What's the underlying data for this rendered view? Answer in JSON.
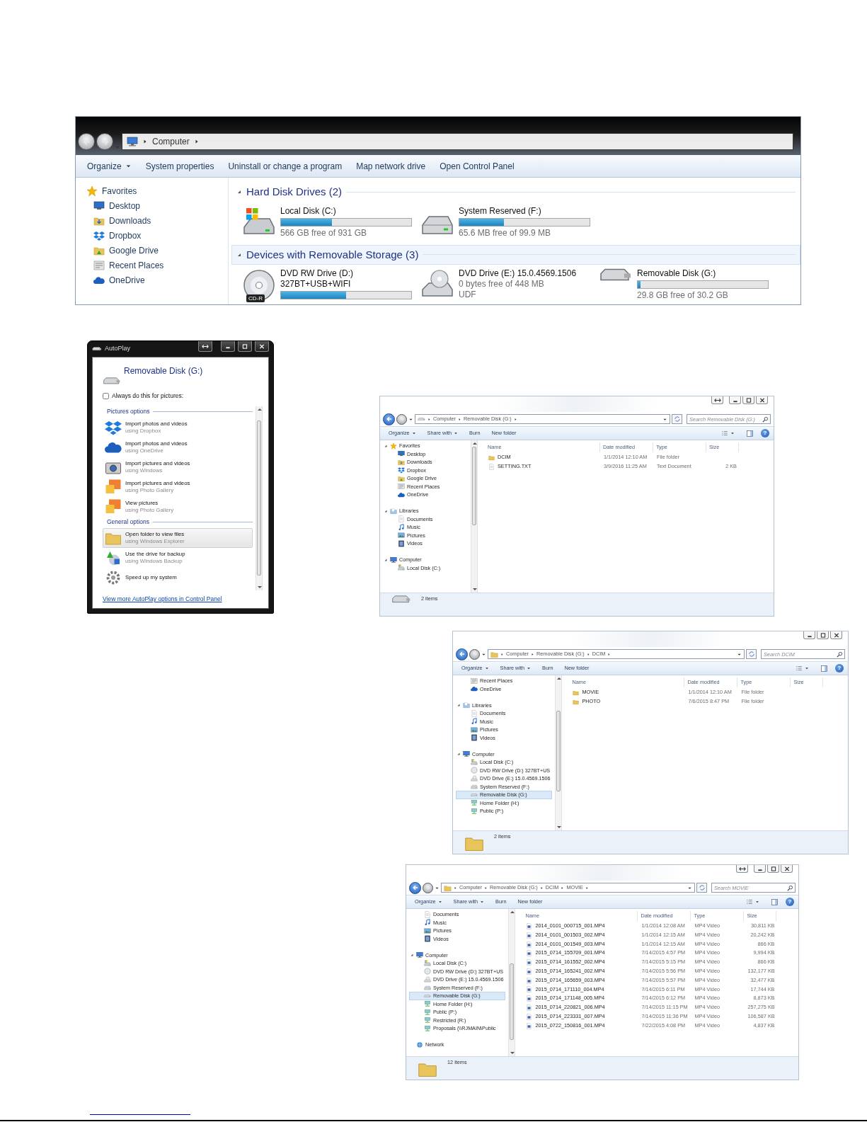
{
  "computer_window": {
    "breadcrumb": [
      "Computer"
    ],
    "toolbar": [
      {
        "label": "Organize",
        "dropdown": true
      },
      {
        "label": "System properties",
        "dropdown": false
      },
      {
        "label": "Uninstall or change a program",
        "dropdown": false
      },
      {
        "label": "Map network drive",
        "dropdown": false
      },
      {
        "label": "Open Control Panel",
        "dropdown": false
      }
    ],
    "sidebar": [
      {
        "label": "Favorites",
        "kind": "star",
        "selected": false,
        "children": [
          {
            "label": "Desktop",
            "kind": "desktop",
            "selected": false
          },
          {
            "label": "Downloads",
            "kind": "downloads",
            "selected": false
          },
          {
            "label": "Dropbox",
            "kind": "dropbox",
            "selected": false
          },
          {
            "label": "Google Drive",
            "kind": "gdrive",
            "selected": false
          },
          {
            "label": "Recent Places",
            "kind": "recent",
            "selected": false
          },
          {
            "label": "OneDrive",
            "kind": "onedrive",
            "selected": false
          }
        ]
      }
    ],
    "groups": [
      {
        "title": "Hard Disk Drives (2)",
        "selected": false,
        "drives": [
          {
            "name": "Local Disk (C:)",
            "kind": "windisk",
            "level": 0.39,
            "lines": [
              "566 GB free of 931 GB"
            ],
            "selected": false
          },
          {
            "name": "System Reserved (F:)",
            "kind": "hdd",
            "level": 0.34,
            "lines": [
              "65.6 MB free of 99.9 MB"
            ],
            "selected": false
          }
        ]
      },
      {
        "title": "Devices with Removable Storage (3)",
        "selected": true,
        "drives": [
          {
            "name": "DVD RW Drive (D:)",
            "kind": "cd",
            "badge": "CD-R",
            "label": "327BT+USB+WIFI",
            "level": 0.5,
            "selected": false
          },
          {
            "name": "DVD Drive (E:) 15.0.4569.1506",
            "kind": "dvd",
            "lines": [
              "0 bytes free of 448 MB",
              "UDF"
            ],
            "selected": false
          },
          {
            "name": "Removable Disk (G:)",
            "kind": "usb",
            "level": 0.02,
            "lines": [
              "29.8 GB free of 30.2 GB"
            ],
            "selected": false
          }
        ]
      }
    ]
  },
  "autoplay": {
    "title": "AutoPlay",
    "device": "Removable Disk (G:)",
    "always": {
      "label": "Always do this for pictures:",
      "checked": false
    },
    "sections": [
      {
        "title": "Pictures options",
        "options": [
          {
            "kind": "dropbox",
            "title": "Import photos and videos",
            "subtitle": "using Dropbox",
            "selected": false
          },
          {
            "kind": "onedrive",
            "title": "Import photos and videos",
            "subtitle": "using OneDrive",
            "selected": false
          },
          {
            "kind": "camera",
            "title": "Import pictures and videos",
            "subtitle": "using Windows",
            "selected": false
          },
          {
            "kind": "gallery",
            "title": "Import pictures and videos",
            "subtitle": "using Photo Gallery",
            "selected": false
          },
          {
            "kind": "gallery",
            "title": "View pictures",
            "subtitle": "using Photo Gallery",
            "selected": false
          }
        ]
      },
      {
        "title": "General options",
        "options": [
          {
            "kind": "folder",
            "title": "Open folder to view files",
            "subtitle": "using Windows Explorer",
            "selected": true
          },
          {
            "kind": "backup",
            "title": "Use the drive for backup",
            "subtitle": "using Windows Backup",
            "selected": false
          },
          {
            "kind": "gear",
            "title": "Speed up my system",
            "selected": false
          }
        ]
      }
    ],
    "link": "View more AutoPlay options in Control Panel"
  },
  "explorers": [
    {
      "breadcrumb": [
        "Computer",
        "Removable Disk (G:)"
      ],
      "search_placeholder": "Search Removable Disk (G:)",
      "toolbar": [
        {
          "label": "Organize",
          "dropdown": true
        },
        {
          "label": "Share with",
          "dropdown": true
        },
        {
          "label": "Burn",
          "dropdown": false
        },
        {
          "label": "New folder",
          "dropdown": false
        }
      ],
      "help": "?",
      "nav": [
        {
          "label": "Favorites",
          "kind": "star",
          "selected": false,
          "children": [
            {
              "label": "Desktop",
              "kind": "desktop",
              "selected": false
            },
            {
              "label": "Downloads",
              "kind": "downloads",
              "selected": false
            },
            {
              "label": "Dropbox",
              "kind": "dropbox",
              "selected": false
            },
            {
              "label": "Google Drive",
              "kind": "gdrive",
              "selected": false
            },
            {
              "label": "Recent Places",
              "kind": "recent",
              "selected": false
            },
            {
              "label": "OneDrive",
              "kind": "onedrive",
              "selected": false
            }
          ]
        },
        {
          "label": "Libraries",
          "kind": "libraries",
          "selected": false,
          "children": [
            {
              "label": "Documents",
              "kind": "documents",
              "selected": false
            },
            {
              "label": "Music",
              "kind": "music",
              "selected": false
            },
            {
              "label": "Pictures",
              "kind": "pictures",
              "selected": false
            },
            {
              "label": "Videos",
              "kind": "videos",
              "selected": false
            }
          ]
        },
        {
          "label": "Computer",
          "kind": "computer",
          "selected": false,
          "children": [
            {
              "label": "Local Disk (C:)",
              "kind": "windisk",
              "selected": false
            }
          ]
        }
      ],
      "columns": [
        "Name",
        "Date modified",
        "Type",
        "Size"
      ],
      "rows": [
        {
          "kind": "folder",
          "name": "DCIM",
          "date": "1/1/2014 12:10 AM",
          "type": "File folder",
          "selected": false
        },
        {
          "kind": "text",
          "name": "SETTING.TXT",
          "date": "3/9/2016 11:25 AM",
          "type": "Text Document",
          "size": "2 KB",
          "selected": false
        }
      ],
      "status": "2 items"
    },
    {
      "breadcrumb": [
        "Computer",
        "Removable Disk (G:)",
        "DCIM"
      ],
      "search_placeholder": "Search DCIM",
      "toolbar": [
        {
          "label": "Organize",
          "dropdown": true
        },
        {
          "label": "Share with",
          "dropdown": true
        },
        {
          "label": "Burn",
          "dropdown": false
        },
        {
          "label": "New folder",
          "dropdown": false
        }
      ],
      "help": "?",
      "nav": [
        {
          "children": [
            {
              "label": "Recent Places",
              "kind": "recent",
              "selected": false
            },
            {
              "label": "OneDrive",
              "kind": "onedrive",
              "selected": false
            }
          ]
        },
        {
          "label": "Libraries",
          "kind": "libraries",
          "selected": false,
          "children": [
            {
              "label": "Documents",
              "kind": "documents",
              "selected": false
            },
            {
              "label": "Music",
              "kind": "music",
              "selected": false
            },
            {
              "label": "Pictures",
              "kind": "pictures",
              "selected": false
            },
            {
              "label": "Videos",
              "kind": "videos",
              "selected": false
            }
          ]
        },
        {
          "label": "Computer",
          "kind": "computer",
          "selected": false,
          "children": [
            {
              "label": "Local Disk (C:)",
              "kind": "windisk",
              "selected": false
            },
            {
              "label": "DVD RW Drive (D:) 327BT+US",
              "kind": "cd",
              "selected": false
            },
            {
              "label": "DVD Drive (E:) 15.0.4569.1506",
              "kind": "dvd",
              "selected": false
            },
            {
              "label": "System Reserved (F:)",
              "kind": "hdd",
              "selected": false
            },
            {
              "label": "Removable Disk (G:)",
              "kind": "usb",
              "selected": true
            },
            {
              "label": "Home Folder (H:)",
              "kind": "netdrive",
              "selected": false
            },
            {
              "label": "Public (P:)",
              "kind": "netdrive",
              "selected": false
            }
          ]
        }
      ],
      "columns": [
        "Name",
        "Date modified",
        "Type",
        "Size"
      ],
      "rows": [
        {
          "kind": "folder",
          "name": "MOVIE",
          "date": "1/1/2014 12:10 AM",
          "type": "File folder",
          "selected": false
        },
        {
          "kind": "folder",
          "name": "PHOTO",
          "date": "7/6/2015 8:47 PM",
          "type": "File folder",
          "selected": false
        }
      ],
      "status": "2 items"
    },
    {
      "breadcrumb": [
        "Computer",
        "Removable Disk (G:)",
        "DCIM",
        "MOVIE"
      ],
      "search_placeholder": "Search MOVIE",
      "toolbar": [
        {
          "label": "Organize",
          "dropdown": true
        },
        {
          "label": "Share with",
          "dropdown": true
        },
        {
          "label": "Burn",
          "dropdown": false
        },
        {
          "label": "New folder",
          "dropdown": false
        }
      ],
      "help": "?",
      "nav": [
        {
          "children": [
            {
              "label": "Documents",
              "kind": "documents",
              "selected": false
            },
            {
              "label": "Music",
              "kind": "music",
              "selected": false
            },
            {
              "label": "Pictures",
              "kind": "pictures",
              "selected": false
            },
            {
              "label": "Videos",
              "kind": "videos",
              "selected": false
            }
          ]
        },
        {
          "label": "Computer",
          "kind": "computer",
          "selected": false,
          "children": [
            {
              "label": "Local Disk (C:)",
              "kind": "windisk",
              "selected": false
            },
            {
              "label": "DVD RW Drive (D:) 327BT+US",
              "kind": "cd",
              "selected": false
            },
            {
              "label": "DVD Drive (E:) 15.0.4569.1506",
              "kind": "dvd",
              "selected": false
            },
            {
              "label": "System Reserved (F:)",
              "kind": "hdd",
              "selected": false
            },
            {
              "label": "Removable Disk (G:)",
              "kind": "usb",
              "selected": true
            },
            {
              "label": "Home Folder (H:)",
              "kind": "netdrive",
              "selected": false
            },
            {
              "label": "Public (P:)",
              "kind": "netdrive",
              "selected": false
            },
            {
              "label": "Restricted (R:)",
              "kind": "netdrive",
              "selected": false
            },
            {
              "label": "Proposals (\\\\RJMAIN\\Public",
              "kind": "netdrive",
              "selected": false
            }
          ]
        },
        {
          "label": "Network",
          "kind": "network",
          "selected": false
        }
      ],
      "columns": [
        "Name",
        "Date modified",
        "Type",
        "Size"
      ],
      "rows": [
        {
          "kind": "video",
          "name": "2014_0101_000715_001.MP4",
          "date": "1/1/2014 12:08 AM",
          "type": "MP4 Video",
          "size": "30,811 KB",
          "selected": false
        },
        {
          "kind": "video",
          "name": "2014_0101_001503_002.MP4",
          "date": "1/1/2014 12:15 AM",
          "type": "MP4 Video",
          "size": "20,242 KB",
          "selected": false
        },
        {
          "kind": "video",
          "name": "2014_0101_001549_003.MP4",
          "date": "1/1/2014 12:15 AM",
          "type": "MP4 Video",
          "size": "866 KB",
          "selected": false
        },
        {
          "kind": "video",
          "name": "2015_0714_155709_001.MP4",
          "date": "7/14/2015 4:57 PM",
          "type": "MP4 Video",
          "size": "9,994 KB",
          "selected": false
        },
        {
          "kind": "video",
          "name": "2015_0714_161552_002.MP4",
          "date": "7/14/2015 5:15 PM",
          "type": "MP4 Video",
          "size": "866 KB",
          "selected": false
        },
        {
          "kind": "video",
          "name": "2015_0714_165241_002.MP4",
          "date": "7/14/2015 5:56 PM",
          "type": "MP4 Video",
          "size": "132,177 KB",
          "selected": false
        },
        {
          "kind": "video",
          "name": "2015_0714_165659_003.MP4",
          "date": "7/14/2015 5:57 PM",
          "type": "MP4 Video",
          "size": "32,477 KB",
          "selected": false
        },
        {
          "kind": "video",
          "name": "2015_0714_171110_004.MP4",
          "date": "7/14/2015 6:11 PM",
          "type": "MP4 Video",
          "size": "17,744 KB",
          "selected": false
        },
        {
          "kind": "video",
          "name": "2015_0714_171148_005.MP4",
          "date": "7/14/2015 6:12 PM",
          "type": "MP4 Video",
          "size": "8,873 KB",
          "selected": false
        },
        {
          "kind": "video",
          "name": "2015_0714_220821_006.MP4",
          "date": "7/14/2015 11:15 PM",
          "type": "MP4 Video",
          "size": "257,275 KB",
          "selected": false
        },
        {
          "kind": "video",
          "name": "2015_0714_223331_007.MP4",
          "date": "7/14/2015 11:36 PM",
          "type": "MP4 Video",
          "size": "106,587 KB",
          "selected": false
        },
        {
          "kind": "video",
          "name": "2015_0722_150816_001.MP4",
          "date": "7/22/2015 4:08 PM",
          "type": "MP4 Video",
          "size": "4,837 KB",
          "selected": false
        }
      ],
      "status": "12 items"
    }
  ]
}
